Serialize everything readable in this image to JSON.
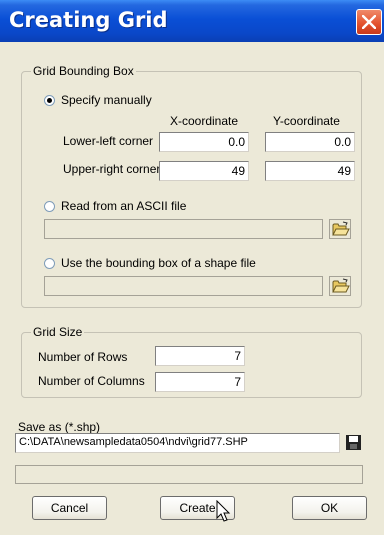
{
  "window": {
    "title": "Creating Grid"
  },
  "bounding_box": {
    "group_label": "Grid Bounding Box",
    "specify_manually_label": "Specify manually",
    "x_header": "X-coordinate",
    "y_header": "Y-coordinate",
    "lower_left_label": "Lower-left corner",
    "lower_left_x": "0.0",
    "lower_left_y": "0.0",
    "upper_right_label": "Upper-right corner",
    "upper_right_x": "49",
    "upper_right_y": "49",
    "ascii_label": "Read from an ASCII file",
    "ascii_path": "",
    "shape_label": "Use the bounding box of a shape file",
    "shape_path": ""
  },
  "grid_size": {
    "group_label": "Grid Size",
    "rows_label": "Number of Rows",
    "rows_value": "7",
    "cols_label": "Number of Columns",
    "cols_value": "7"
  },
  "save": {
    "label": "Save as (*.shp)",
    "path": "C:\\DATA\\newsampledata0504\\ndvi\\grid77.SHP"
  },
  "buttons": {
    "cancel": "Cancel",
    "create": "Create",
    "ok": "OK"
  }
}
